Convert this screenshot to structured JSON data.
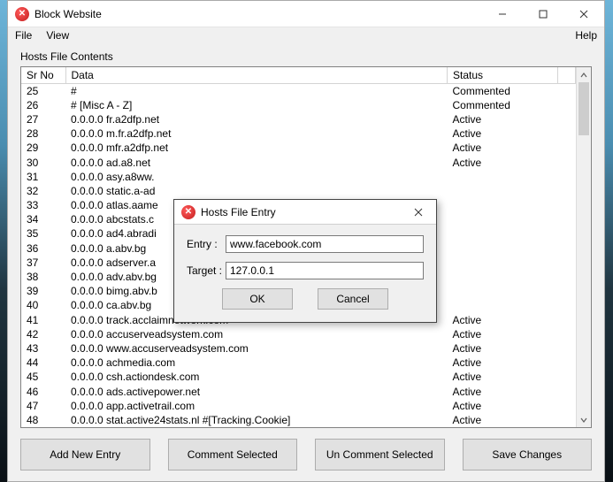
{
  "window": {
    "title": "Block Website"
  },
  "menu": {
    "file": "File",
    "view": "View",
    "help": "Help"
  },
  "section_label": "Hosts File Contents",
  "columns": {
    "srno": "Sr No",
    "data": "Data",
    "status": "Status"
  },
  "rows": [
    {
      "sr": "25",
      "data": "#",
      "status": "Commented"
    },
    {
      "sr": "26",
      "data": "# [Misc A - Z]",
      "status": "Commented"
    },
    {
      "sr": "27",
      "data": "0.0.0.0 fr.a2dfp.net",
      "status": "Active"
    },
    {
      "sr": "28",
      "data": "0.0.0.0 m.fr.a2dfp.net",
      "status": "Active"
    },
    {
      "sr": "29",
      "data": "0.0.0.0 mfr.a2dfp.net",
      "status": "Active"
    },
    {
      "sr": "30",
      "data": "0.0.0.0 ad.a8.net",
      "status": "Active"
    },
    {
      "sr": "31",
      "data": "0.0.0.0 asy.a8ww.",
      "status": ""
    },
    {
      "sr": "32",
      "data": "0.0.0.0 static.a-ad",
      "status": ""
    },
    {
      "sr": "33",
      "data": "0.0.0.0 atlas.aame",
      "status": ""
    },
    {
      "sr": "34",
      "data": "0.0.0.0 abcstats.c",
      "status": ""
    },
    {
      "sr": "35",
      "data": "0.0.0.0 ad4.abradi",
      "status": ""
    },
    {
      "sr": "36",
      "data": "0.0.0.0 a.abv.bg",
      "status": ""
    },
    {
      "sr": "37",
      "data": "0.0.0.0 adserver.a",
      "status": ""
    },
    {
      "sr": "38",
      "data": "0.0.0.0 adv.abv.bg",
      "status": ""
    },
    {
      "sr": "39",
      "data": "0.0.0.0 bimg.abv.b",
      "status": ""
    },
    {
      "sr": "40",
      "data": "0.0.0.0 ca.abv.bg",
      "status": ""
    },
    {
      "sr": "41",
      "data": "0.0.0.0 track.acclaimnetwork.com",
      "status": "Active"
    },
    {
      "sr": "42",
      "data": "0.0.0.0 accuserveadsystem.com",
      "status": "Active"
    },
    {
      "sr": "43",
      "data": "0.0.0.0 www.accuserveadsystem.com",
      "status": "Active"
    },
    {
      "sr": "44",
      "data": "0.0.0.0 achmedia.com",
      "status": "Active"
    },
    {
      "sr": "45",
      "data": "0.0.0.0 csh.actiondesk.com",
      "status": "Active"
    },
    {
      "sr": "46",
      "data": "0.0.0.0 ads.activepower.net",
      "status": "Active"
    },
    {
      "sr": "47",
      "data": "0.0.0.0 app.activetrail.com",
      "status": "Active"
    },
    {
      "sr": "48",
      "data": "0.0.0.0 stat.active24stats.nl #[Tracking.Cookie]",
      "status": "Active"
    }
  ],
  "buttons": {
    "add": "Add New Entry",
    "comment": "Comment Selected",
    "uncomment": "Un Comment Selected",
    "save": "Save Changes"
  },
  "dialog": {
    "title": "Hosts File Entry",
    "entry_label": "Entry :",
    "entry_value": "www.facebook.com",
    "target_label": "Target :",
    "target_value": "127.0.0.1",
    "ok": "OK",
    "cancel": "Cancel"
  }
}
